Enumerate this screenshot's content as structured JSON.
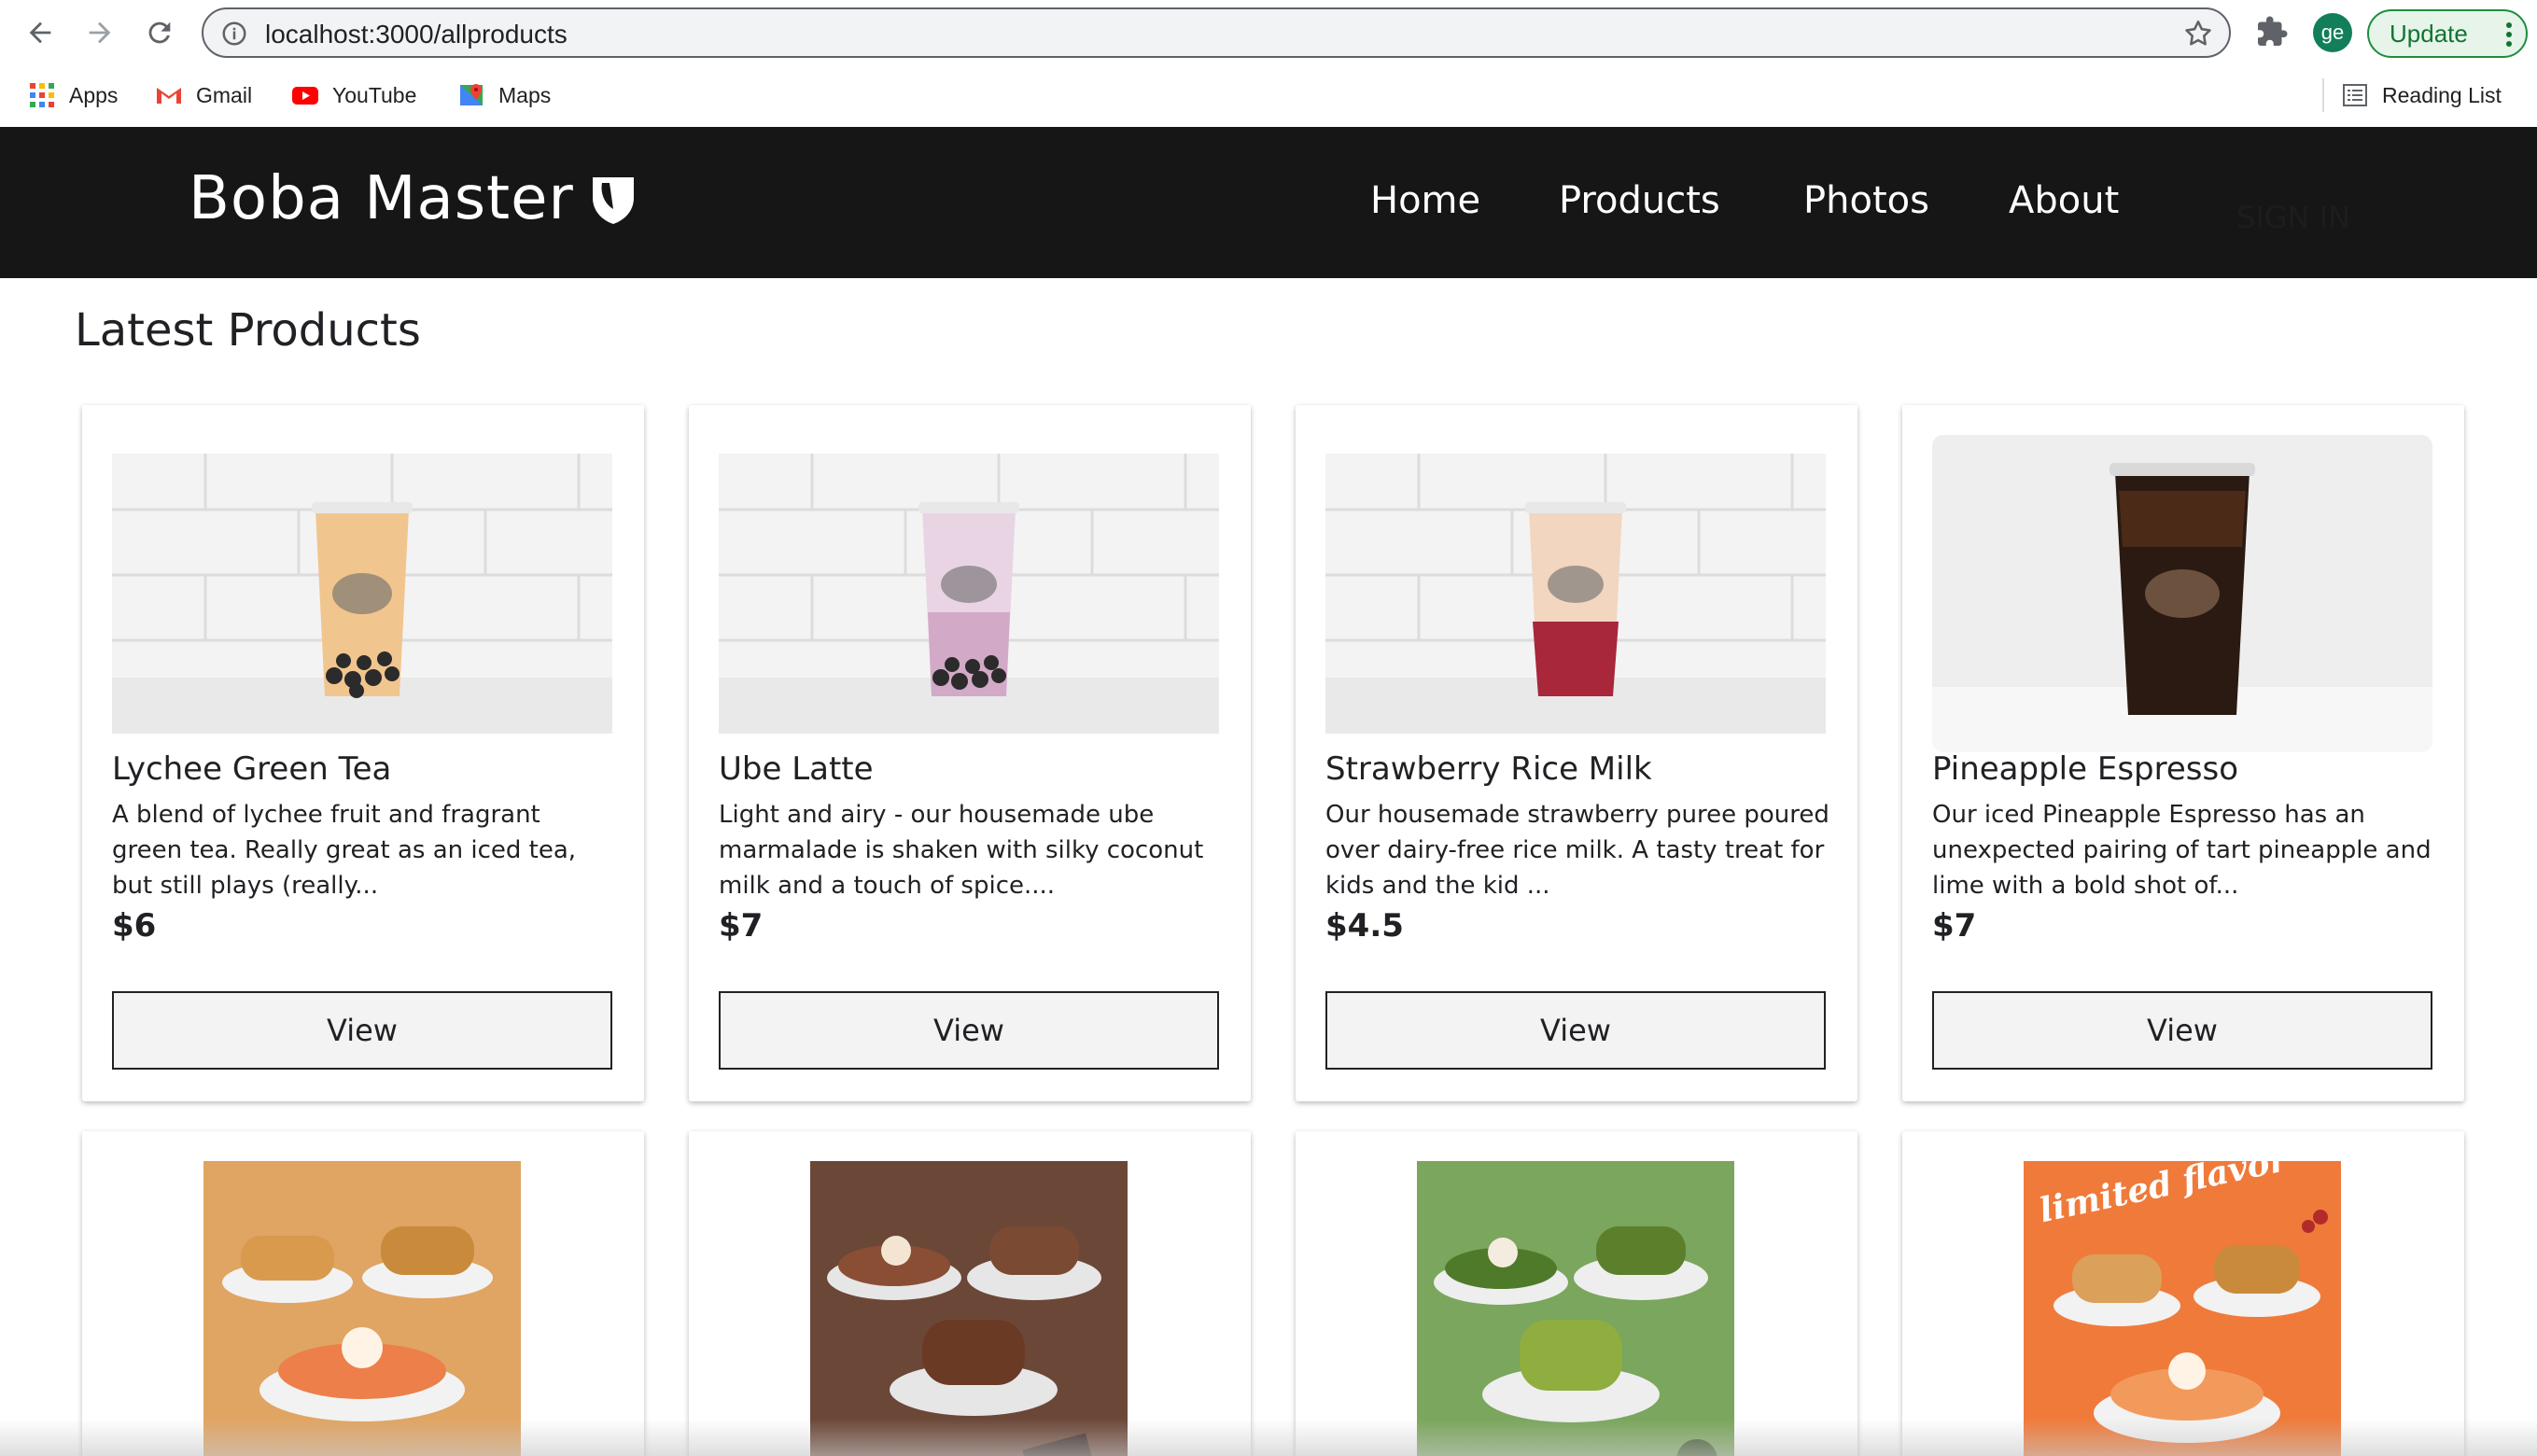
{
  "browser": {
    "url": "localhost:3000/allproducts",
    "profile_initials": "ge",
    "update_label": "Update",
    "bookmarks": [
      {
        "label": "Apps",
        "icon": "apps-grid-icon"
      },
      {
        "label": "Gmail",
        "icon": "gmail-icon"
      },
      {
        "label": "YouTube",
        "icon": "youtube-icon"
      },
      {
        "label": "Maps",
        "icon": "maps-icon"
      }
    ],
    "reading_list_label": "Reading List"
  },
  "site": {
    "brand": "Boba Master",
    "nav": [
      {
        "label": "Home"
      },
      {
        "label": "Products"
      },
      {
        "label": "Photos"
      },
      {
        "label": "About"
      }
    ],
    "signin_label": "SIGN IN"
  },
  "page": {
    "section_title": "Latest Products",
    "products": [
      {
        "name": "Lychee Green Tea",
        "description": "A blend of lychee fruit and fragrant green tea. Really great as an iced tea, but still plays (really...",
        "price": "$6",
        "button": "View",
        "image": "lychee-green-tea-image"
      },
      {
        "name": "Ube Latte",
        "description": "Light and airy - our housemade ube marmalade is shaken with silky coconut milk and a touch of spice....",
        "price": "$7",
        "button": "View",
        "image": "ube-latte-image"
      },
      {
        "name": "Strawberry Rice Milk",
        "description": "Our housemade strawberry puree poured over dairy-free rice milk. A tasty treat for kids and the kid ...",
        "price": "$4.5",
        "button": "View",
        "image": "strawberry-rice-milk-image"
      },
      {
        "name": "Pineapple Espresso",
        "description": "Our iced Pineapple Espresso has an unexpected pairing of tart pineapple and lime with a bold shot of...",
        "price": "$7",
        "button": "View",
        "image": "pineapple-espresso-image"
      }
    ],
    "second_row": [
      {
        "image": "waffles-pancakes-orange-image",
        "bg": "#e0a463"
      },
      {
        "image": "chocolate-waffles-image",
        "bg": "#6b4738"
      },
      {
        "image": "matcha-waffles-image",
        "bg": "#7aa65d"
      },
      {
        "image": "limited-flavor-waffles-image",
        "bg": "#f07a3a",
        "overlay_text": "limited flavor"
      }
    ]
  },
  "colors": {
    "header_bg": "#161616",
    "accent_green": "#137e5a"
  }
}
